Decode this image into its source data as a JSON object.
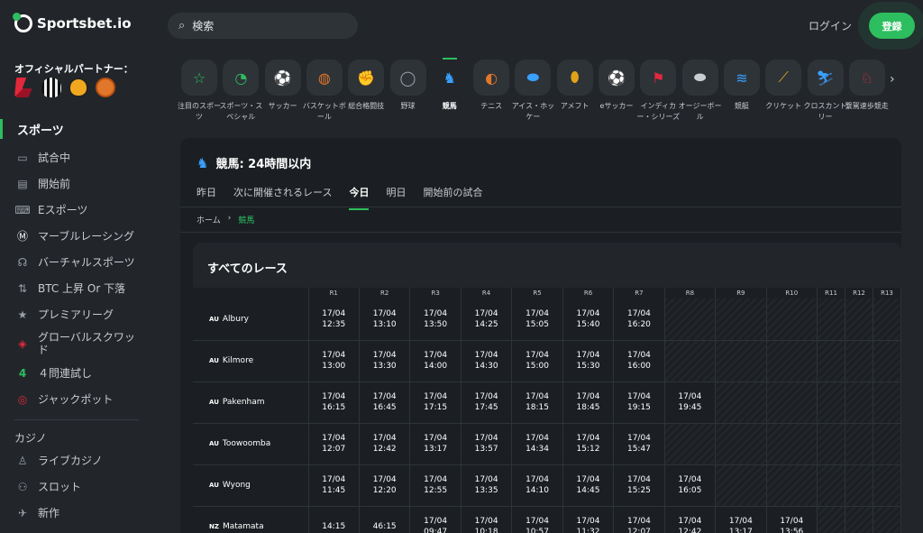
{
  "brand": {
    "name": "Sportsbet.io"
  },
  "partners": {
    "title": "オフィシャルパートナー："
  },
  "nav": {
    "section": "スポーツ",
    "items": [
      {
        "label": "試合中",
        "icon": "monitor-icon"
      },
      {
        "label": "開始前",
        "icon": "calendar-icon"
      },
      {
        "label": "Eスポーツ",
        "icon": "gamepad-icon"
      },
      {
        "label": "マーブルレーシング",
        "icon": "marble-icon"
      },
      {
        "label": "バーチャルスポーツ",
        "icon": "headset-icon"
      },
      {
        "label": "BTC 上昇 Or 下落",
        "icon": "updown-icon"
      },
      {
        "label": "プレミアリーグ",
        "icon": "star-icon"
      },
      {
        "label": "グローバルスクワッド",
        "icon": "squad-icon"
      },
      {
        "label": "４問連試し",
        "icon": "four-icon"
      },
      {
        "label": "ジャックポット",
        "icon": "target-icon"
      }
    ],
    "casino_title": "カジノ",
    "casino_items": [
      {
        "label": "ライブカジノ",
        "icon": "dealer-icon"
      },
      {
        "label": "スロット",
        "icon": "slot-icon"
      },
      {
        "label": "新作",
        "icon": "rocket-icon"
      }
    ]
  },
  "search": {
    "value": "検索"
  },
  "header": {
    "login": "ログイン",
    "register": "登録"
  },
  "sports": [
    {
      "label": "注目のスポーツ",
      "icon": "star-icon",
      "glyph": "☆",
      "color": "#2dbe5f"
    },
    {
      "label": "スポーツ・スペシャル",
      "icon": "special-icon",
      "glyph": "◔",
      "color": "#2dbe5f"
    },
    {
      "label": "サッカー",
      "icon": "soccer-icon",
      "glyph": "⚽",
      "color": "#e2283b"
    },
    {
      "label": "バスケットボール",
      "icon": "basketball-icon",
      "glyph": "◍",
      "color": "#e0772a"
    },
    {
      "label": "総合格闘技",
      "icon": "mma-icon",
      "glyph": "✊",
      "color": "#f1c21b"
    },
    {
      "label": "野球",
      "icon": "baseball-icon",
      "glyph": "◯",
      "color": "#9aa0a6"
    },
    {
      "label": "競馬",
      "icon": "horse-racing-icon",
      "glyph": "♞",
      "color": "#3aa0ff"
    },
    {
      "label": "テニス",
      "icon": "tennis-icon",
      "glyph": "◐",
      "color": "#e0772a"
    },
    {
      "label": "アイス・ホッケー",
      "icon": "ice-hockey-icon",
      "glyph": "⬬",
      "color": "#3aa0ff"
    },
    {
      "label": "アメフト",
      "icon": "american-football-icon",
      "glyph": "⬮",
      "color": "#e0a21a"
    },
    {
      "label": "eサッカー",
      "icon": "esoccer-icon",
      "glyph": "⚽",
      "color": "#e2283b"
    },
    {
      "label": "インディカー・シリーズ",
      "icon": "indycar-icon",
      "glyph": "⚑",
      "color": "#e2283b"
    },
    {
      "label": "オージーボール",
      "icon": "aussie-rules-icon",
      "glyph": "⬬",
      "color": "#c9ccd0"
    },
    {
      "label": "競艇",
      "icon": "boat-racing-icon",
      "glyph": "≋",
      "color": "#3aa0ff"
    },
    {
      "label": "クリケット",
      "icon": "cricket-icon",
      "glyph": "⟋",
      "color": "#e0a21a"
    },
    {
      "label": "クロスカントリー",
      "icon": "cross-country-icon",
      "glyph": "⛷",
      "color": "#3aa0ff"
    },
    {
      "label": "繋駕速歩競走",
      "icon": "harness-racing-icon",
      "glyph": "♘",
      "color": "#e2283b"
    }
  ],
  "card": {
    "title": "競馬: 24時間以内",
    "tabs": [
      "昨日",
      "次に開催されるレース",
      "今日",
      "明日",
      "開始前の試合"
    ],
    "active_tab": 2,
    "breadcrumb": [
      "ホーム",
      "競馬"
    ]
  },
  "races": {
    "title": "すべてのレース",
    "columns": [
      "R1",
      "R2",
      "R3",
      "R4",
      "R5",
      "R6",
      "R7",
      "R8",
      "R9",
      "R10",
      "R11",
      "R12",
      "R13"
    ],
    "rows": [
      {
        "country": "AU",
        "track": "Albury",
        "times": [
          [
            "17/04",
            "12:35"
          ],
          [
            "17/04",
            "13:10"
          ],
          [
            "17/04",
            "13:50"
          ],
          [
            "17/04",
            "14:25"
          ],
          [
            "17/04",
            "15:05"
          ],
          [
            "17/04",
            "15:40"
          ],
          [
            "17/04",
            "16:20"
          ],
          null,
          null,
          null,
          null,
          null,
          null
        ]
      },
      {
        "country": "AU",
        "track": "Kilmore",
        "times": [
          [
            "17/04",
            "13:00"
          ],
          [
            "17/04",
            "13:30"
          ],
          [
            "17/04",
            "14:00"
          ],
          [
            "17/04",
            "14:30"
          ],
          [
            "17/04",
            "15:00"
          ],
          [
            "17/04",
            "15:30"
          ],
          [
            "17/04",
            "16:00"
          ],
          null,
          null,
          null,
          null,
          null,
          null
        ]
      },
      {
        "country": "AU",
        "track": "Pakenham",
        "times": [
          [
            "17/04",
            "16:15"
          ],
          [
            "17/04",
            "16:45"
          ],
          [
            "17/04",
            "17:15"
          ],
          [
            "17/04",
            "17:45"
          ],
          [
            "17/04",
            "18:15"
          ],
          [
            "17/04",
            "18:45"
          ],
          [
            "17/04",
            "19:15"
          ],
          [
            "17/04",
            "19:45"
          ],
          null,
          null,
          null,
          null,
          null
        ]
      },
      {
        "country": "AU",
        "track": "Toowoomba",
        "times": [
          [
            "17/04",
            "12:07"
          ],
          [
            "17/04",
            "12:42"
          ],
          [
            "17/04",
            "13:17"
          ],
          [
            "17/04",
            "13:57"
          ],
          [
            "17/04",
            "14:34"
          ],
          [
            "17/04",
            "15:12"
          ],
          [
            "17/04",
            "15:47"
          ],
          null,
          null,
          null,
          null,
          null,
          null
        ]
      },
      {
        "country": "AU",
        "track": "Wyong",
        "times": [
          [
            "17/04",
            "11:45"
          ],
          [
            "17/04",
            "12:20"
          ],
          [
            "17/04",
            "12:55"
          ],
          [
            "17/04",
            "13:35"
          ],
          [
            "17/04",
            "14:10"
          ],
          [
            "17/04",
            "14:45"
          ],
          [
            "17/04",
            "15:25"
          ],
          [
            "17/04",
            "16:05"
          ],
          null,
          null,
          null,
          null,
          null
        ]
      },
      {
        "country": "NZ",
        "track": "Matamata",
        "times": [
          [
            "14:15"
          ],
          [
            "46:15"
          ],
          [
            "17/04",
            "09:47"
          ],
          [
            "17/04",
            "10:18"
          ],
          [
            "17/04",
            "10:57"
          ],
          [
            "17/04",
            "11:32"
          ],
          [
            "17/04",
            "12:07"
          ],
          [
            "17/04",
            "12:42"
          ],
          [
            "17/04",
            "13:17"
          ],
          [
            "17/04",
            "13:56"
          ],
          null,
          null,
          null
        ]
      }
    ]
  }
}
